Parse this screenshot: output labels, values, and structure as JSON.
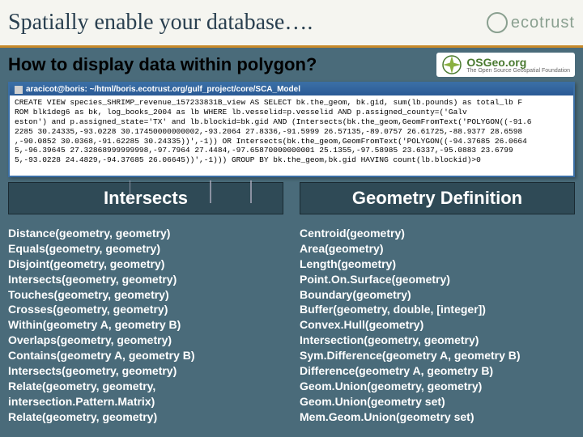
{
  "title": "Spatially enable your database….",
  "logo_text": "ecotrust",
  "subtitle": "How to display data within polygon?",
  "osgeo": {
    "text": "OSGeo.org",
    "sub": "The Open Source Geospatial Foundation"
  },
  "sql_window_title": "aracicot@boris: ~/html/boris.ecotrust.org/gulf_project/core/SCA_Model",
  "sql_body": "CREATE VIEW species_SHRIMP_revenue_157233831B_view AS SELECT bk.the_geom, bk.gid, sum(lb.pounds) as total_lb F\nROM blk1deg6 as bk, log_books_2004 as lb WHERE lb.vesselid=p.vesselid AND p.assigned_county=('Galv\neston') and p.assigned_state='TX' and lb.blockid=bk.gid AND (Intersects(bk.the_geom,GeomFromText('POLYGON((-91.6\n2285 30.24335,-93.0228 30.17450000000002,-93.2064 27.8336,-91.5999 26.57135,-89.0757 26.61725,-88.9377 28.6598\n,-90.0852 30.0368,-91.62285 30.24335))',-1)) OR Intersects(bk.the_geom,GeomFromText('POLYGON((-94.37685 26.0664\n5,-96.39645 27.32868999999998,-97.7964 27.4484,-97.65870000000001 25.1355,-97.58985 23.6337,-95.0883 23.6799\n5,-93.0228 24.4829,-94.37685 26.06645))',-1))) GROUP BY bk.the_geom,bk.gid HAVING count(lb.blockid)>0",
  "left_col": {
    "header": "Intersects",
    "items": [
      "Distance(geometry, geometry)",
      "Equals(geometry, geometry)",
      "Disjoint(geometry, geometry)",
      "Intersects(geometry, geometry)",
      "Touches(geometry, geometry)",
      "Crosses(geometry, geometry)",
      "Within(geometry A, geometry B)",
      "Overlaps(geometry, geometry)",
      "Contains(geometry A, geometry B)",
      "Intersects(geometry, geometry)",
      "Relate(geometry, geometry, intersection.Pattern.Matrix)",
      "Relate(geometry, geometry)"
    ]
  },
  "right_col": {
    "header": "Geometry Definition",
    "items": [
      "Centroid(geometry)",
      "Area(geometry)",
      "Length(geometry)",
      "Point.On.Surface(geometry)",
      "Boundary(geometry)",
      "Buffer(geometry, double, [integer])",
      "Convex.Hull(geometry)",
      "Intersection(geometry, geometry)",
      "Sym.Difference(geometry A, geometry B)",
      "Difference(geometry A, geometry B)",
      "Geom.Union(geometry, geometry)",
      "Geom.Union(geometry set)",
      "Mem.Geom.Union(geometry set)"
    ]
  }
}
